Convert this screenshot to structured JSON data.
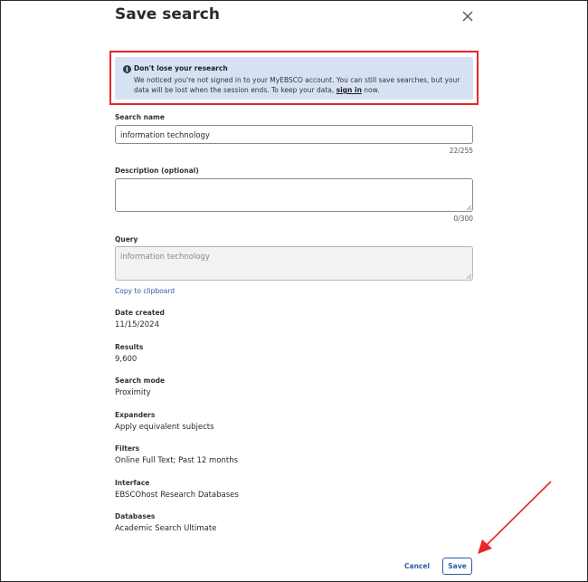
{
  "dialog": {
    "title": "Save search",
    "close_icon": "close-icon"
  },
  "alert": {
    "icon": "info-icon",
    "icon_glyph": "i",
    "title": "Don't lose your research",
    "body_before": "We noticed you're not signed in to your MyEBSCO account. You can still save searches, but your data will be lost when the session ends. To keep your data, ",
    "link": "sign in",
    "body_after": " now."
  },
  "search_name": {
    "label": "Search name",
    "value": "information technology",
    "counter": "22/255"
  },
  "description": {
    "label": "Description (optional)",
    "value": "",
    "counter": "0/300"
  },
  "query": {
    "label": "Query",
    "value": "information technology",
    "copy_link": "Copy to clipboard"
  },
  "details": [
    {
      "label": "Date created",
      "value": "11/15/2024"
    },
    {
      "label": "Results",
      "value": "9,600"
    },
    {
      "label": "Search mode",
      "value": "Proximity"
    },
    {
      "label": "Expanders",
      "value": "Apply equivalent subjects"
    },
    {
      "label": "Filters",
      "value": "Online Full Text; Past 12 months"
    },
    {
      "label": "Interface",
      "value": "EBSCOhost Research Databases"
    },
    {
      "label": "Databases",
      "value": "Academic Search Ultimate"
    }
  ],
  "footer": {
    "cancel_label": "Cancel",
    "save_label": "Save"
  },
  "colors": {
    "accent": "#2d5ba8",
    "alert_bg": "#d6e2f4",
    "highlight_red": "#e8262b"
  }
}
